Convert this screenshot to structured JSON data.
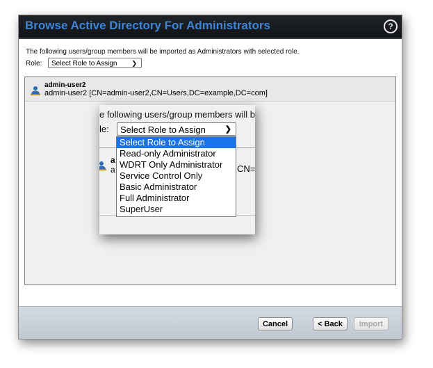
{
  "dialog": {
    "title": "Browse Active Directory For Administrators",
    "help_glyph": "?"
  },
  "intro_text": "The following users/group members will be imported as Administrators with selected role.",
  "role": {
    "label": "Role:",
    "selected": "Select Role to Assign",
    "options": [
      "Select Role to Assign",
      "Read-only Administrator",
      "WDRT Only Administrator",
      "Service Control Only",
      "Basic Administrator",
      "Full Administrator",
      "SuperUser"
    ]
  },
  "users": [
    {
      "name": "admin-user2",
      "dn": "admin-user2 [CN=admin-user2,CN=Users,DC=example,DC=com]"
    }
  ],
  "zoom": {
    "intro_fragment": "e following users/group members will be",
    "role_fragment": "le:",
    "name_fragment": "a",
    "dn_fragment": "a",
    "cn_fragment": "CN="
  },
  "footer": {
    "cancel_label": "Cancel",
    "back_label": "< Back",
    "import_label": "Import"
  },
  "colors": {
    "title_text": "#3d86d6",
    "titlebar_bg": "#1a1c20",
    "selected_option": "#1a73e8"
  }
}
